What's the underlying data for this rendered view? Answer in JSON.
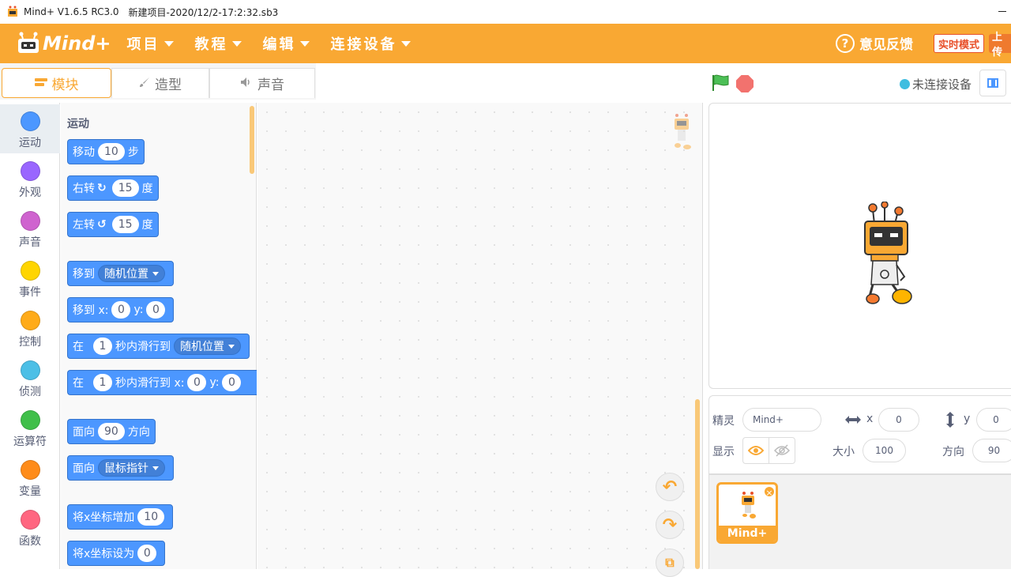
{
  "window": {
    "app_name": "Mind+ V1.6.5 RC3.0",
    "file_name": "新建项目-2020/12/2-17:2:32.sb3"
  },
  "menubar": {
    "logo_text": "Mind+",
    "menus": [
      "项目",
      "教程",
      "编辑",
      "连接设备"
    ],
    "feedback_label": "意见反馈",
    "realtime_label": "实时模式",
    "upload_label": "上传"
  },
  "tabs": [
    {
      "label": "模块",
      "icon": "blocks-icon",
      "active": true
    },
    {
      "label": "造型",
      "icon": "brush-icon",
      "active": false
    },
    {
      "label": "声音",
      "icon": "speaker-icon",
      "active": false
    }
  ],
  "stage_controls": {
    "connection_status": "未连接设备"
  },
  "categories": [
    {
      "label": "运动",
      "color": "#4c97ff"
    },
    {
      "label": "外观",
      "color": "#9966ff"
    },
    {
      "label": "声音",
      "color": "#cf63cf"
    },
    {
      "label": "事件",
      "color": "#ffd500"
    },
    {
      "label": "控制",
      "color": "#ffab19"
    },
    {
      "label": "侦测",
      "color": "#4cbfe6"
    },
    {
      "label": "运算符",
      "color": "#40bf4a"
    },
    {
      "label": "变量",
      "color": "#ff8c1a"
    },
    {
      "label": "函数",
      "color": "#ff6680"
    }
  ],
  "palette": {
    "section_title": "运动",
    "blocks": {
      "move": {
        "text": "移动",
        "value": "10",
        "suffix": "步"
      },
      "turn_right": {
        "text": "右转",
        "value": "15",
        "suffix": "度"
      },
      "turn_left": {
        "text": "左转",
        "value": "15",
        "suffix": "度"
      },
      "goto": {
        "text": "移到",
        "option": "随机位置"
      },
      "goto_xy": {
        "text": "移到 x:",
        "x": "0",
        "y_label": "y:",
        "y": "0"
      },
      "glide": {
        "text": "在",
        "secs": "1",
        "mid": "秒内滑行到",
        "option": "随机位置"
      },
      "glide_xy": {
        "text": "在",
        "secs": "1",
        "mid": "秒内滑行到 x:",
        "x": "0",
        "y_label": "y:",
        "y": "0"
      },
      "point_dir": {
        "text": "面向",
        "value": "90",
        "suffix": "方向"
      },
      "point_towards": {
        "text": "面向",
        "option": "鼠标指针"
      },
      "change_x": {
        "text": "将x坐标增加",
        "value": "10"
      },
      "set_x": {
        "text": "将x坐标设为",
        "value": "0"
      }
    }
  },
  "sprite_info": {
    "sprite_label": "精灵",
    "sprite_name": "Mind+",
    "x_label": "x",
    "x_value": "0",
    "y_label": "y",
    "y_value": "0",
    "show_label": "显示",
    "size_label": "大小",
    "size_value": "100",
    "direction_label": "方向",
    "direction_value": "90"
  },
  "sprite_list": {
    "items": [
      {
        "name": "Mind+"
      }
    ]
  },
  "colors": {
    "accent": "#f9a833",
    "motion_block": "#4c97ff"
  }
}
